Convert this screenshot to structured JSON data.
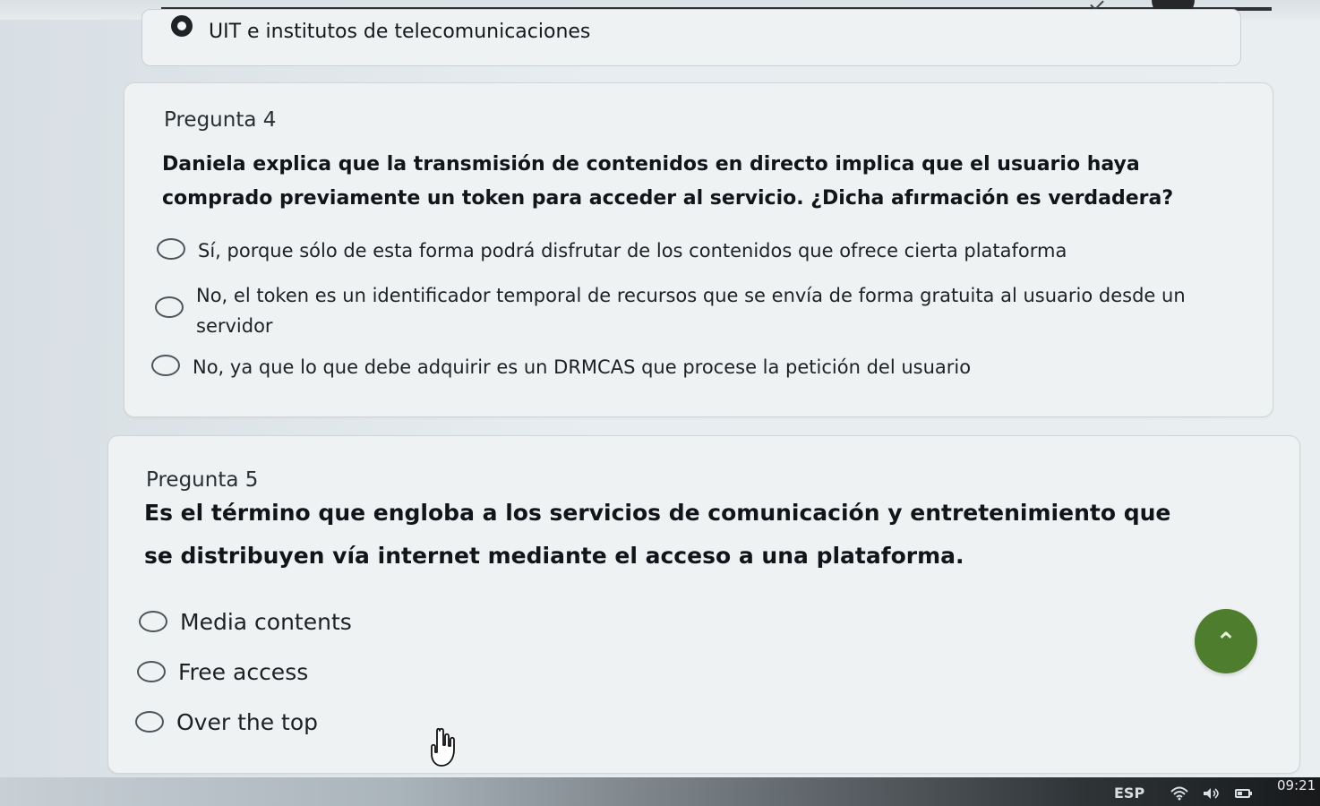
{
  "header": {
    "previous_selected_option": "UIT e institutos de telecomunicaciones"
  },
  "questions": [
    {
      "number": "Pregunta 4",
      "text": "Daniela explica que la transmisión de contenidos en directo implica que el usuario haya comprado previamente un token para acceder al servicio. ¿Dicha afırmación es verdadera?",
      "options": [
        "Sí, porque sólo de esta forma podrá disfrutar de los contenidos que ofrece cierta plataforma",
        "No, el token es un identificador temporal de recursos que se envía de forma gratuita al usuario desde un servidor",
        "No, ya que lo que debe adquirir es un DRMCAS que procese la petición del usuario"
      ]
    },
    {
      "number": "Pregunta 5",
      "text": "Es el término que engloba a los servicios de comunicación y entretenimiento que se distribuyen vía internet mediante el acceso a una plataforma.",
      "options": [
        "Media contents",
        "Free access",
        "Over the top"
      ]
    }
  ],
  "floating_button": {
    "icon": "double-chevron-up-icon",
    "glyph": "⌃",
    "color": "#4f7d2e"
  },
  "taskbar": {
    "language": "ESP",
    "time": "09:21",
    "wifi_icon": "wifi-icon",
    "volume_icon": "volume-icon",
    "battery_icon": "battery-icon"
  },
  "colors": {
    "page_background": "#e7edf0",
    "card_background": "#eef2f3",
    "accent_green": "#4f7d2e"
  }
}
